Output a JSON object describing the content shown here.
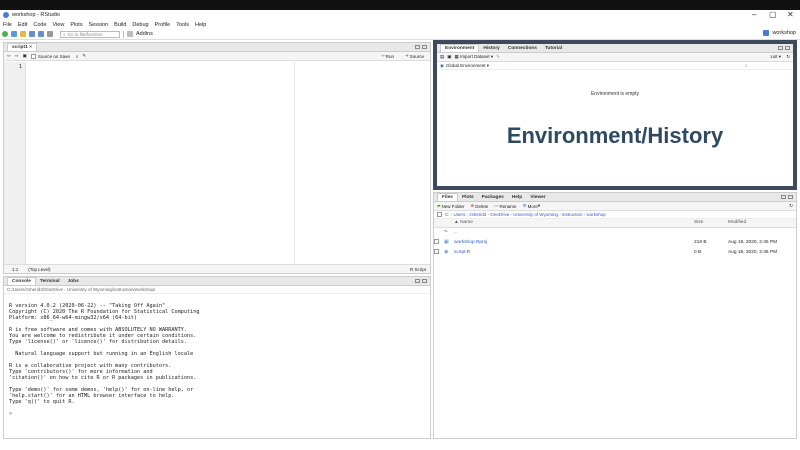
{
  "window": {
    "title": "workshop - RStudio",
    "controls": [
      "–",
      "▢",
      "✕"
    ]
  },
  "menu": [
    "File",
    "Edit",
    "Code",
    "View",
    "Plots",
    "Session",
    "Build",
    "Debug",
    "Profile",
    "Tools",
    "Help"
  ],
  "toolbar": {
    "goto_placeholder": "Go to file/function",
    "addins_label": "Addins",
    "project_label": "workshop"
  },
  "editor": {
    "tab_label": "script1",
    "source_on_save": "Source on Save",
    "run_label": "Run",
    "source_label": "Source",
    "line_number": "1",
    "position": "1:1",
    "scope": "(Top Level)",
    "file_type": "R Script"
  },
  "console": {
    "tabs": [
      "Console",
      "Terminal",
      "Jobs"
    ],
    "path": "C:/Users/zsherid3/OneDrive - University of Wyoming/instruction/workshop/",
    "lines": [
      "R version 4.0.2 (2020-06-22) -- \"Taking Off Again\"",
      "Copyright (C) 2020 The R Foundation for Statistical Computing",
      "Platform: x86_64-w64-mingw32/x64 (64-bit)",
      "",
      "R is free software and comes with ABSOLUTELY NO WARRANTY.",
      "You are welcome to redistribute it under certain conditions.",
      "Type 'license()' or 'licence()' for distribution details.",
      "",
      "  Natural language support but running in an English locale",
      "",
      "R is a collaborative project with many contributors.",
      "Type 'contributors()' for more information and",
      "'citation()' on how to cite R or R packages in publications.",
      "",
      "Type 'demo()' for some demos, 'help()' for on-line help, or",
      "'help.start()' for an HTML browser interface to help.",
      "Type 'q()' to quit R.",
      "",
      "> "
    ]
  },
  "environment": {
    "tabs": [
      "Environment",
      "History",
      "Connections",
      "Tutorial"
    ],
    "import_label": "Import Dataset",
    "list_label": "List",
    "scope_label": "Global Environment",
    "empty_msg": "Environment is empty",
    "overlay_title": "Environment/History"
  },
  "files": {
    "tabs": [
      "Files",
      "Plots",
      "Packages",
      "Help",
      "Viewer"
    ],
    "actions": [
      "New Folder",
      "Delete",
      "Rename",
      "More"
    ],
    "breadcrumb": [
      "C:",
      "Users",
      "zsherid3",
      "OneDrive - University of Wyoming",
      "instruction",
      "workshop"
    ],
    "headers": {
      "name": "Name",
      "size": "Size",
      "modified": "Modified"
    },
    "up_label": "..",
    "rows": [
      {
        "name": "workshop.Rproj",
        "size": "218 B",
        "modified": "Aug 19, 2020, 2:45 PM"
      },
      {
        "name": "script.R",
        "size": "0 B",
        "modified": "Aug 19, 2020, 2:46 PM"
      }
    ]
  },
  "colors": {
    "overlay_border": "#3d4a5c",
    "overlay_text": "#2e4a62",
    "link": "#2c5dc0"
  }
}
